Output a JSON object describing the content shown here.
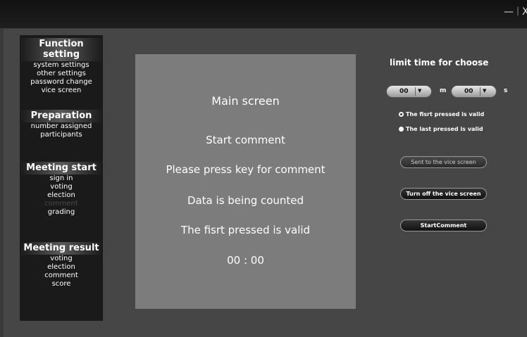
{
  "window_controls": {
    "minimize": "—",
    "close": "X"
  },
  "sidebar": {
    "groups": [
      {
        "header": "Function setting",
        "items": [
          {
            "label": "system settings"
          },
          {
            "label": "other settings"
          },
          {
            "label": "password change"
          },
          {
            "label": "vice screen"
          }
        ]
      },
      {
        "header": "Preparation",
        "items": [
          {
            "label": "number assigned"
          },
          {
            "label": "participants"
          }
        ]
      },
      {
        "header": "Meeting start",
        "items": [
          {
            "label": "sign in"
          },
          {
            "label": "voting"
          },
          {
            "label": "election"
          },
          {
            "label": "comment",
            "state": "disabled"
          },
          {
            "label": "grading"
          }
        ]
      },
      {
        "header": "Meeting result",
        "items": [
          {
            "label": "voting"
          },
          {
            "label": "election"
          },
          {
            "label": "comment"
          },
          {
            "label": "score"
          }
        ]
      }
    ]
  },
  "main_screen": {
    "title": "Main screen",
    "lines": [
      "Start comment",
      "Please press key for comment",
      "Data is being counted",
      "The fisrt pressed is valid",
      "00 : 00"
    ]
  },
  "limit_time": {
    "title": "limit time for choose",
    "minutes_value": "00",
    "minutes_unit": "m",
    "seconds_value": "00",
    "seconds_unit": "s",
    "options": [
      {
        "label": "The fisrt pressed is valid",
        "checked": true
      },
      {
        "label": "The last pressed is valid",
        "checked": false
      }
    ]
  },
  "buttons": {
    "sent_vice": "Sent to the vice screen",
    "turn_off_vice": "Turn off the vice screen",
    "start_comment": "StartComment"
  }
}
